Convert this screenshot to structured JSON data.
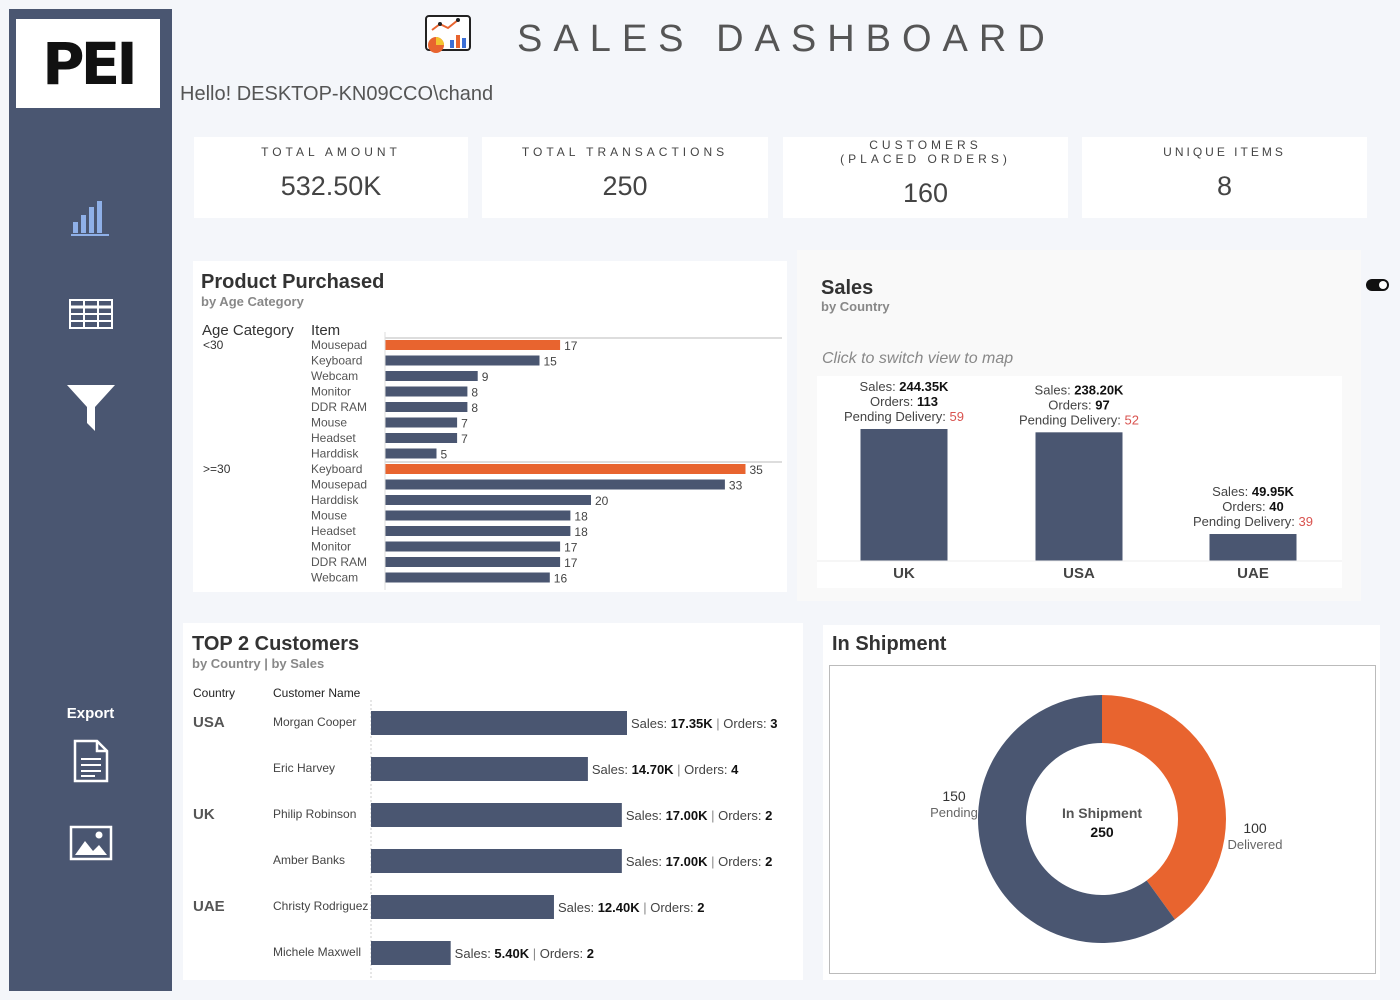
{
  "app": {
    "logo_text": "PEI",
    "title": "SALES DASHBOARD",
    "greeting": "Hello! DESKTOP-KN09CCO\\chand"
  },
  "sidebar": {
    "icons": [
      "bar-chart-icon",
      "table-icon",
      "filter-icon"
    ],
    "export_label": "Export",
    "export_icons": [
      "document-icon",
      "image-icon"
    ]
  },
  "kpis": [
    {
      "label": "TOTAL AMOUNT",
      "value": "532.50K"
    },
    {
      "label": "TOTAL TRANSACTIONS",
      "value": "250"
    },
    {
      "label": "CUSTOMERS",
      "label2": "(PLACED ORDERS)",
      "value": "160"
    },
    {
      "label": "UNIQUE ITEMS",
      "value": "8"
    }
  ],
  "product_panel": {
    "title": "Product Purchased",
    "subtitle": "by Age Category",
    "col_age": "Age Category",
    "col_item": "Item"
  },
  "sales_panel": {
    "title": "Sales",
    "subtitle": "by Country",
    "hint": "Click to switch view to map",
    "sales_label": "Sales:",
    "orders_label": "Orders:",
    "pending_label": "Pending Delivery:"
  },
  "customers_panel": {
    "title": "TOP 2 Customers",
    "subtitle": "by Country | by Sales",
    "col_country": "Country",
    "col_name": "Customer Name",
    "sales_label": "Sales:",
    "orders_label": "Orders:"
  },
  "shipment_panel": {
    "title": "In Shipment",
    "center_label": "In Shipment",
    "center_value": "250",
    "pending_value": "150",
    "pending_label": "Pending",
    "delivered_value": "100",
    "delivered_label": "Delivered"
  },
  "colors": {
    "navy": "#4a5671",
    "orange": "#e8642f",
    "red_text": "#d9534f",
    "bar_label": "#333333"
  },
  "chart_data": [
    {
      "type": "bar",
      "orientation": "horizontal",
      "groups": [
        {
          "name": "<30",
          "categories": [
            "Mousepad",
            "Keyboard",
            "Webcam",
            "Monitor",
            "DDR RAM",
            "Mouse",
            "Headset",
            "Harddisk"
          ],
          "values": [
            17,
            15,
            9,
            8,
            8,
            7,
            7,
            5
          ],
          "highlight": "Mousepad"
        },
        {
          "name": ">=30",
          "categories": [
            "Keyboard",
            "Mousepad",
            "Harddisk",
            "Mouse",
            "Headset",
            "Monitor",
            "DDR RAM",
            "Webcam"
          ],
          "values": [
            35,
            33,
            20,
            18,
            18,
            17,
            17,
            16
          ],
          "highlight": "Keyboard"
        }
      ],
      "xlim": [
        0,
        40
      ]
    },
    {
      "type": "bar",
      "categories": [
        "UK",
        "USA",
        "UAE"
      ],
      "values": [
        244.35,
        238.2,
        49.95
      ],
      "sales_text": [
        "244.35K",
        "238.20K",
        "49.95K"
      ],
      "orders": [
        113,
        97,
        40
      ],
      "pending_delivery": [
        59,
        52,
        39
      ],
      "ylim": [
        0,
        260
      ]
    },
    {
      "type": "bar",
      "orientation": "horizontal",
      "rows": [
        {
          "country": "USA",
          "name": "Morgan Cooper",
          "sales": 17.35,
          "sales_text": "17.35K",
          "orders": 3
        },
        {
          "country": "",
          "name": "Eric Harvey",
          "sales": 14.7,
          "sales_text": "14.70K",
          "orders": 4
        },
        {
          "country": "UK",
          "name": "Philip Robinson",
          "sales": 17.0,
          "sales_text": "17.00K",
          "orders": 2
        },
        {
          "country": "",
          "name": "Amber Banks",
          "sales": 17.0,
          "sales_text": "17.00K",
          "orders": 2
        },
        {
          "country": "UAE",
          "name": "Christy Rodriguez",
          "sales": 12.4,
          "sales_text": "12.40K",
          "orders": 2
        },
        {
          "country": "",
          "name": "Michele Maxwell",
          "sales": 5.4,
          "sales_text": "5.40K",
          "orders": 2
        }
      ],
      "xlim": [
        0,
        17.35
      ]
    },
    {
      "type": "pie",
      "donut": true,
      "labels": [
        "Delivered",
        "Pending"
      ],
      "values": [
        100,
        150
      ],
      "total": 250
    }
  ]
}
